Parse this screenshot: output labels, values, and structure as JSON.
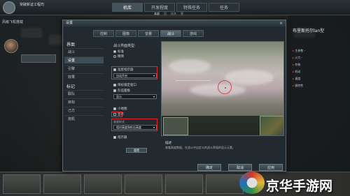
{
  "top": {
    "title": "突破新证工程司",
    "nav_tabs": [
      "机库",
      "开发程度",
      "特殊任务",
      "任务"
    ],
    "nav_sub": [
      "本部",
      "设",
      "技术",
      "更"
    ],
    "right_text": ""
  },
  "left_panel": {
    "lines": [
      "风级飞机搭载",
      "",
      "",
      "",
      ""
    ]
  },
  "right_panel": {
    "title": "布里斯托尔lan型",
    "sub": "",
    "items": [
      {
        "label": "主参数",
        "value": "-"
      },
      {
        "label": "火力",
        "value": "-"
      },
      {
        "label": "作装",
        "value": ""
      },
      {
        "label": "机动",
        "value": ""
      },
      {
        "label": "速度",
        "value": ""
      },
      {
        "label": "操控性",
        "value": ""
      },
      {
        "label": "",
        "value": ""
      }
    ]
  },
  "dialog": {
    "title": "设置",
    "close": "×",
    "tabs": [
      "控制",
      "图像",
      "音量",
      "战斗",
      "游戏"
    ],
    "active_tab": 3,
    "nav_sections": [
      {
        "header": "界面",
        "items": [
          "战斗",
          "设置",
          "引擎",
          "效果"
        ]
      },
      {
        "header": "标记",
        "items": [
          "联队",
          "目标",
          "己方",
          "炮机"
        ]
      }
    ],
    "selected_nav": "设置",
    "options": {
      "section_title": "战斗界面类型:",
      "radio_1": "标准",
      "radio_2": "精简",
      "check_1": "准星指示器",
      "select_1": "自动开启",
      "check_2": "目标锁定窗口",
      "check_3": "队伍面板",
      "select_2": "显示",
      "check_4": "小地图",
      "check_5": "显示",
      "select_3_label": "准星样式",
      "select_3": "相对高度和射击高度",
      "check_6": "指示器",
      "button": "重置"
    },
    "preview": {
      "hud_texts": [
        "",
        "",
        ""
      ]
    },
    "description": {
      "title": "描述",
      "text": "查看高度数据，在战斗中自定义的战斗界面的显示元素。"
    },
    "buttons": {
      "ok": "确定",
      "cancel": "取消",
      "apply": "应用"
    }
  },
  "watermark": {
    "text": "京华手游网"
  }
}
